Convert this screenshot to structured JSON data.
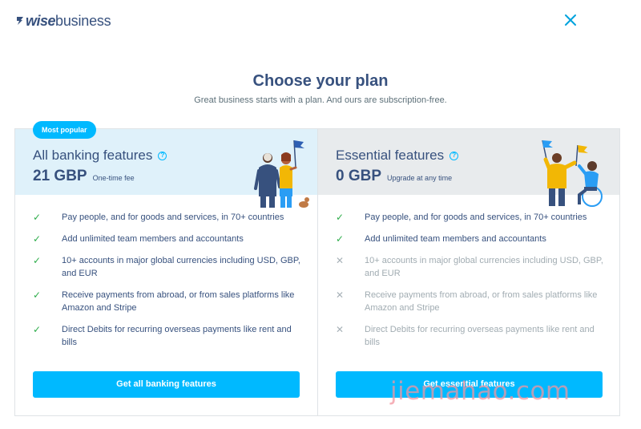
{
  "header": {
    "logo_bold": "wise",
    "logo_light": "business",
    "close_icon": "close-icon"
  },
  "page": {
    "title": "Choose your plan",
    "subtitle": "Great business starts with a plan. And ours are subscription-free."
  },
  "plans": [
    {
      "badge": "Most popular",
      "name": "All banking features",
      "price": "21 GBP",
      "price_note": "One-time fee",
      "cta": "Get all banking features",
      "features": [
        {
          "text": "Pay people, and for goods and services, in 70+ countries",
          "included": true
        },
        {
          "text": "Add unlimited team members and accountants",
          "included": true
        },
        {
          "text": "10+ accounts in major global currencies including USD, GBP, and EUR",
          "included": true
        },
        {
          "text": "Receive payments from abroad, or from sales platforms like Amazon and Stripe",
          "included": true
        },
        {
          "text": "Direct Debits for recurring overseas payments like rent and bills",
          "included": true
        }
      ]
    },
    {
      "name": "Essential features",
      "price": "0 GBP",
      "price_note": "Upgrade at any time",
      "cta": "Get essential features",
      "features": [
        {
          "text": "Pay people, and for goods and services, in 70+ countries",
          "included": true
        },
        {
          "text": "Add unlimited team members and accountants",
          "included": true
        },
        {
          "text": "10+ accounts in major global currencies including USD, GBP, and EUR",
          "included": false
        },
        {
          "text": "Receive payments from abroad, or from sales platforms like Amazon and Stripe",
          "included": false
        },
        {
          "text": "Direct Debits for recurring overseas payments like rent and bills",
          "included": false
        }
      ]
    }
  ],
  "symbols": {
    "check": "✓",
    "cross": "✕",
    "help": "?"
  },
  "colors": {
    "accent": "#00b9ff",
    "navy": "#37517e",
    "check": "#2ead4b"
  },
  "watermark": "jiemahao.com"
}
